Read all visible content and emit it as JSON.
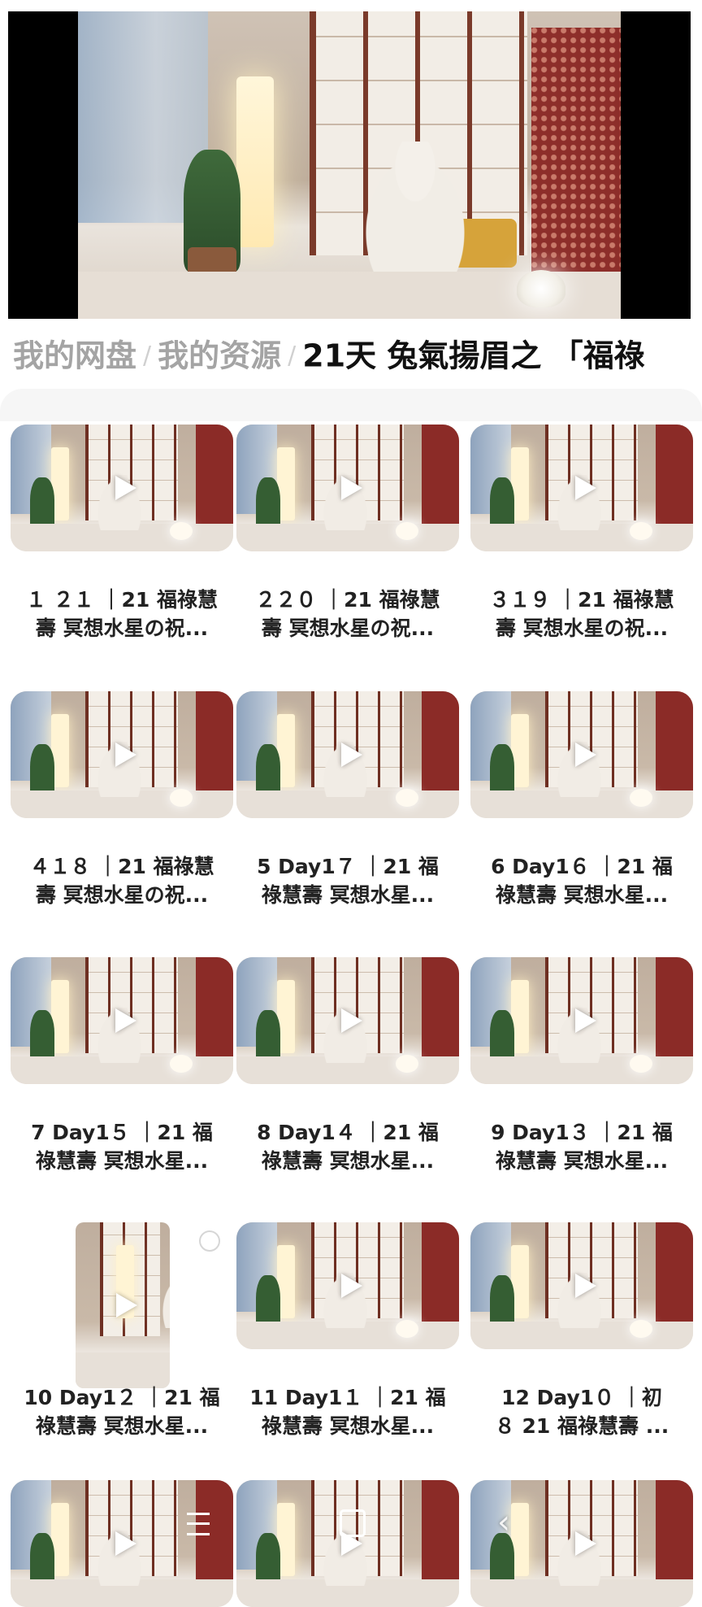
{
  "breadcrumb": {
    "root": "我的网盘",
    "parent": "我的资源",
    "current": "21天 兔氣揚眉之 「福祿"
  },
  "videos": [
    {
      "line1": "１ ２１ ｜21 福祿慧",
      "line2": "壽 冥想水星の祝..."
    },
    {
      "line1": "２２０ ｜21 福祿慧",
      "line2": "壽 冥想水星の祝..."
    },
    {
      "line1": "３１９ ｜21 福祿慧",
      "line2": "壽 冥想水星の祝..."
    },
    {
      "line1": "４１８ ｜21 福祿慧",
      "line2": "壽 冥想水星の祝..."
    },
    {
      "line1": "5 Day1７ ｜21 福",
      "line2": "祿慧壽 冥想水星..."
    },
    {
      "line1": "6 Day1６ ｜21 福",
      "line2": "祿慧壽 冥想水星..."
    },
    {
      "line1": "7 Day1５ ｜21 福",
      "line2": "祿慧壽 冥想水星..."
    },
    {
      "line1": "8 Day1４ ｜21 福",
      "line2": "祿慧壽 冥想水星..."
    },
    {
      "line1": "9 Day1３ ｜21 福",
      "line2": "祿慧壽 冥想水星..."
    },
    {
      "line1": "10 Day1２ ｜21 福",
      "line2": "祿慧壽 冥想水星..."
    },
    {
      "line1": "11 Day1１ ｜21 福",
      "line2": "祿慧壽 冥想水星..."
    },
    {
      "line1": "12 Day1０ ｜初",
      "line2": "８ 21 福祿慧壽 ..."
    }
  ],
  "nav": {
    "menu_icon": "menu-icon",
    "home_icon": "home-square-icon",
    "back_icon": "back-icon",
    "back_glyph": "‹"
  }
}
